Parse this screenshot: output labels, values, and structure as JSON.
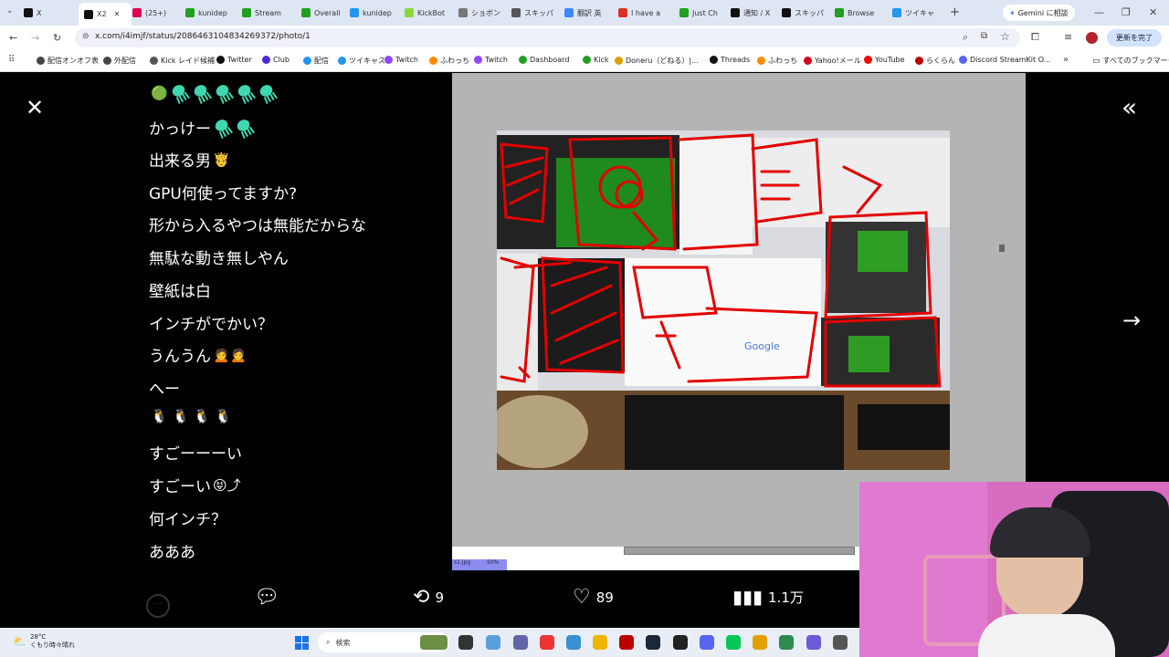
{
  "tabs": [
    {
      "label": "X",
      "color": "#111"
    },
    {
      "label": "X2",
      "color": "#111",
      "active": true
    },
    {
      "label": "(25+)",
      "color": "#e2004f"
    },
    {
      "label": "kunidep",
      "color": "#1fa01f"
    },
    {
      "label": "Stream",
      "color": "#1fa01f"
    },
    {
      "label": "Overall",
      "color": "#1fa01f"
    },
    {
      "label": "kunidep",
      "color": "#2196f3"
    },
    {
      "label": "KickBot",
      "color": "#8cd63a"
    },
    {
      "label": "ショボン",
      "color": "#777"
    },
    {
      "label": "スキッパ",
      "color": "#555"
    },
    {
      "label": "翻訳 英",
      "color": "#4285f4"
    },
    {
      "label": "I have a",
      "color": "#d93025"
    },
    {
      "label": "Just Ch",
      "color": "#1fa01f"
    },
    {
      "label": "通知 / X",
      "color": "#111"
    },
    {
      "label": "スキッパ",
      "color": "#111"
    },
    {
      "label": "Browse",
      "color": "#1fa01f"
    },
    {
      "label": "ツイキャ",
      "color": "#2196f3"
    }
  ],
  "gemini_button": "Gemini に相談",
  "url": "x.com/i4imjf/status/2086463104834269372/photo/1",
  "update_button": "更新を完了",
  "bookmarks": [
    {
      "label": "配信オンオフ表",
      "color": "#444"
    },
    {
      "label": "外配信",
      "color": "#444"
    },
    {
      "label": "Kick レイド候補",
      "color": "#555"
    },
    {
      "label": "Twitter",
      "color": "#111"
    },
    {
      "label": "Club",
      "color": "#4a2bd6"
    },
    {
      "label": "配信",
      "color": "#2196f3"
    },
    {
      "label": "ツイキャス",
      "color": "#2196f3"
    },
    {
      "label": "Twitch",
      "color": "#9146ff"
    },
    {
      "label": "ふわっち",
      "color": "#ff8a00"
    },
    {
      "label": "Twitch",
      "color": "#9146ff"
    },
    {
      "label": "Dashboard",
      "color": "#1fa01f"
    },
    {
      "label": "Kick",
      "color": "#1fa01f"
    },
    {
      "label": "Doneru（どねる）|...",
      "color": "#e09f00"
    },
    {
      "label": "Threads",
      "color": "#111"
    },
    {
      "label": "ふわっち",
      "color": "#ff8a00"
    },
    {
      "label": "Yahoo!メール",
      "color": "#d0021b"
    },
    {
      "label": "YouTube",
      "color": "#ff0000"
    },
    {
      "label": "らくらん",
      "color": "#b00"
    },
    {
      "label": "Discord StreamKit O...",
      "color": "#5865f2"
    }
  ],
  "bookmarks_all": "すべてのブックマーク",
  "chat": [
    {
      "text": "",
      "emoji": "🟢",
      "jellies": 5
    },
    {
      "text": "かっけー",
      "emoji": "",
      "jellies": 2
    },
    {
      "text": "出来る男",
      "emoji": "🤴",
      "jellies": 0
    },
    {
      "text": "GPU何使ってますか?",
      "emoji": "",
      "jellies": 0
    },
    {
      "text": "形から入るやつは無能だからな",
      "emoji": "",
      "jellies": 0
    },
    {
      "text": "無駄な動き無しやん",
      "emoji": "",
      "jellies": 0
    },
    {
      "text": "壁紙は白",
      "emoji": "",
      "jellies": 0
    },
    {
      "text": "インチがでかい？",
      "emoji": "",
      "jellies": 0
    },
    {
      "text": "うんうん",
      "emoji": "🙍🙍",
      "jellies": 0
    },
    {
      "text": "へー",
      "emoji": "",
      "jellies": 0
    },
    {
      "text": "",
      "emoji": "🐧 🐧 🐧 🐧",
      "jellies": 0
    },
    {
      "text": "すごーーーい",
      "emoji": "",
      "jellies": 0
    },
    {
      "text": "すごーい",
      "emoji": "😝⤴",
      "jellies": 0
    },
    {
      "text": "何インチ？",
      "emoji": "",
      "jellies": 0
    },
    {
      "text": "あああ",
      "emoji": "",
      "jellies": 0
    }
  ],
  "photo": {
    "google_text": "Google"
  },
  "strip_file": "s1.jpg",
  "strip_zoom": "50%",
  "actions": {
    "reply": "",
    "repost": "9",
    "like": "89",
    "views": "1.1万"
  },
  "weather": {
    "temp": "28°C",
    "desc": "くもり時々晴れ"
  },
  "taskbar_search": "検索"
}
